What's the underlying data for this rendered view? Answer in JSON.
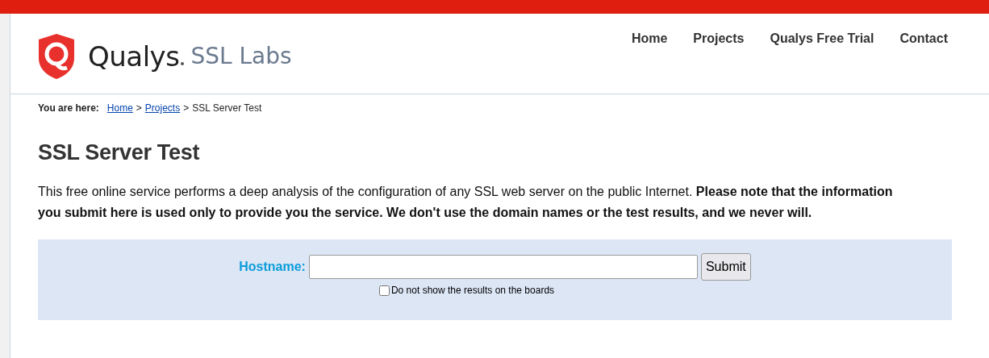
{
  "logo": {
    "brand": "Qualys",
    "product": "SSL Labs"
  },
  "nav": [
    {
      "label": "Home"
    },
    {
      "label": "Projects"
    },
    {
      "label": "Qualys Free Trial"
    },
    {
      "label": "Contact"
    }
  ],
  "breadcrumb": {
    "prefix": "You are here:",
    "links": [
      "Home",
      "Projects"
    ],
    "separator": ">",
    "current": "SSL Server Test"
  },
  "page_title": "SSL Server Test",
  "intro": "This free online service performs a deep analysis of the configuration of any SSL web server on the public Internet. **Please note that the information you submit here is used only to provide you the service. We don't use the domain names or the test results, and we never will.**",
  "form": {
    "label": "Hostname:",
    "submit": "Submit",
    "option": {
      "label": "Do not show the results on the boards",
      "checked": false
    }
  }
}
